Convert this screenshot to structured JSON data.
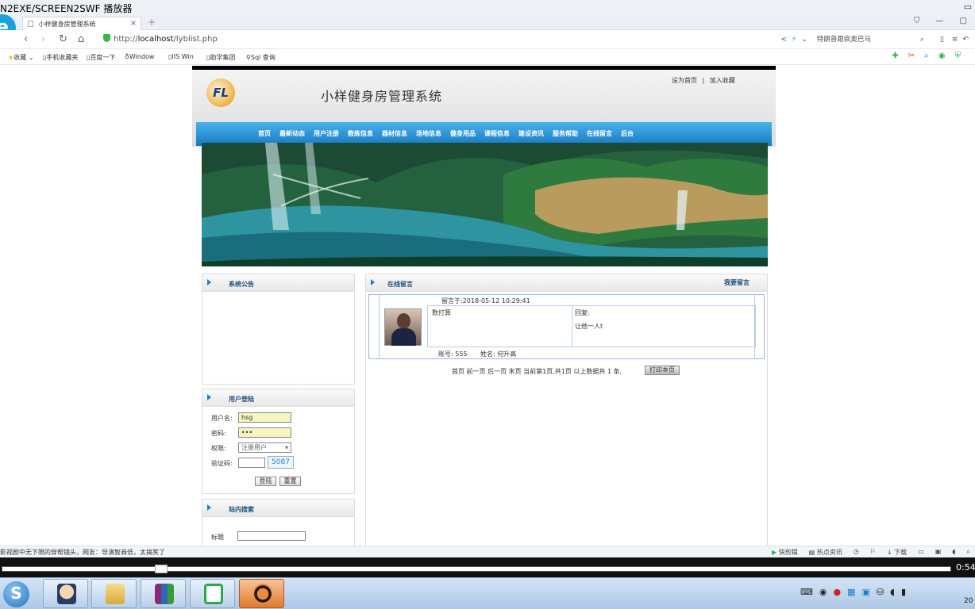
{
  "window": {
    "title": "N2EXE/SCREEN2SWF 播放器"
  },
  "browser": {
    "logo": "e",
    "tab_title": "小样健身房管理系统",
    "tab_close": "×",
    "new_tab": "+",
    "url_prefix": "http://",
    "url_host": "localhost",
    "url_path": "/lyblist.php",
    "search_text": "特朗普跟疯奥巴马",
    "bookmarks": [
      "收藏",
      "手机收藏夹",
      "百度一下",
      "Window",
      "IIS Win",
      "助学集团",
      "Sql 查询"
    ]
  },
  "site": {
    "logo_text": "FL",
    "title": "小样健身房管理系统",
    "top_link_home": "设为首页",
    "top_link_sep": "|",
    "top_link_fav": "加入收藏",
    "menu": [
      "首页",
      "最新动态",
      "用户注册",
      "教练信息",
      "器材信息",
      "场地信息",
      "健身用品",
      "课程信息",
      "建设资讯",
      "服务帮助",
      "在线留言",
      "后台"
    ]
  },
  "sidebar": {
    "notice_title": "系统公告",
    "login_title": "用户登陆",
    "username_label": "用户名:",
    "username_value": "hsg",
    "password_label": "密码:",
    "password_value": "•••",
    "role_label": "权限:",
    "role_value": "注册用户",
    "captcha_label": "验证码:",
    "captcha_code": "5087",
    "login_button": "登陆",
    "reset_button": "重置",
    "search_title": "站内搜索",
    "search_label": "标题"
  },
  "main": {
    "title": "在线留言",
    "action": "我要留言",
    "message": {
      "time_label": "留言于:2018-05-12 10:29:41",
      "content": "数打算",
      "reply_label": "回复:",
      "reply_text": "让他一人t",
      "account": "账号: 555",
      "name": "姓名: 何升高"
    },
    "pagination": "首页 前一页 后一页 末页 当前第1页,共1页 以上数据共 1 条,",
    "print_button": "打印本页"
  },
  "statusbar": {
    "left": "影视剧中无下限的穿帮镜头，网友：导演智商低，太搞笑了",
    "items": [
      "快剪辑",
      "热点资讯",
      "下载"
    ]
  },
  "player": {
    "time": "0:54"
  },
  "taskbar": {
    "clock": "20"
  },
  "colors": {
    "menu_blue": "#1f8bd6",
    "accent_blue": "#1a7fc6",
    "input_yellow": "#f5f5c0"
  }
}
